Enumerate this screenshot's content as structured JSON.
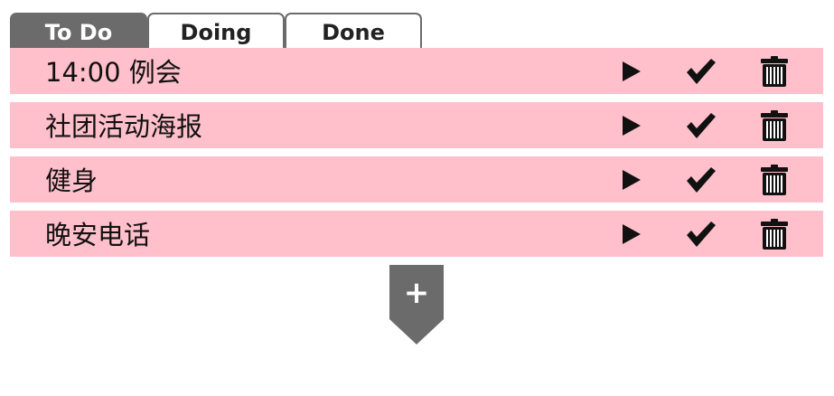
{
  "tabs": [
    {
      "label": "To Do",
      "active": true
    },
    {
      "label": "Doing",
      "active": false
    },
    {
      "label": "Done",
      "active": false
    }
  ],
  "items": [
    {
      "text": "14:00 例会"
    },
    {
      "text": "社团活动海报"
    },
    {
      "text": "健身"
    },
    {
      "text": "晚安电话"
    }
  ],
  "actions": {
    "start_icon": "play-icon",
    "complete_icon": "check-icon",
    "delete_icon": "trash-icon"
  },
  "add_button": {
    "label": "+"
  },
  "colors": {
    "item_background": "#ffc0cb",
    "tab_active": "#6b6b6b",
    "tab_border": "#6b6b6b",
    "add_button": "#6b6b6b",
    "icon": "#111111"
  }
}
